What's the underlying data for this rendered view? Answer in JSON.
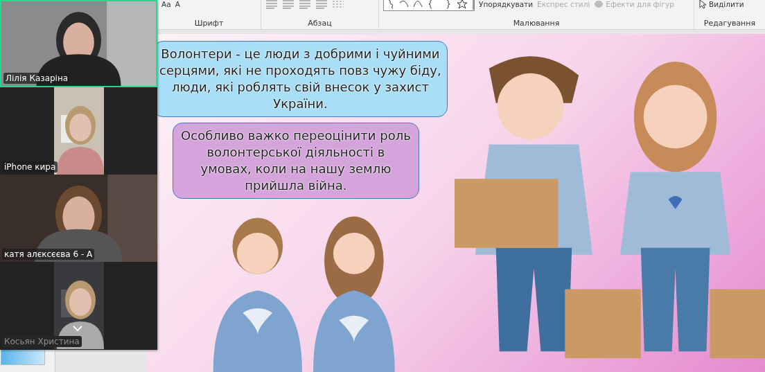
{
  "ribbon": {
    "groups": [
      {
        "label": "Шрифт",
        "items": [
          {
            "kind": "text",
            "label": "Aa",
            "disabled": false
          },
          {
            "kind": "text",
            "label": "A",
            "disabled": false
          }
        ]
      },
      {
        "label": "Абзац",
        "items": [
          {
            "kind": "align"
          },
          {
            "kind": "align"
          },
          {
            "kind": "align"
          },
          {
            "kind": "align"
          },
          {
            "kind": "list"
          }
        ]
      },
      {
        "label": "Малювання",
        "items": [
          {
            "kind": "shapes"
          },
          {
            "kind": "text",
            "label": "Упорядкувати",
            "disabled": false
          },
          {
            "kind": "text",
            "label": "Експрес стилі",
            "disabled": true
          },
          {
            "kind": "effects",
            "label": "Ефекти для фігур",
            "disabled": true
          }
        ]
      },
      {
        "label": "Редагування",
        "items": [
          {
            "kind": "select",
            "label": "Виділити",
            "disabled": false
          }
        ]
      }
    ]
  },
  "participants": [
    {
      "name": "Лілія Казаріна",
      "active": true,
      "dimmed": false,
      "kind": "wide"
    },
    {
      "name": "iPhone кира",
      "active": false,
      "dimmed": false,
      "kind": "portrait"
    },
    {
      "name": "катя алєксєєва 6 - А",
      "active": false,
      "dimmed": false,
      "kind": "wide"
    },
    {
      "name": "Косьян Христина",
      "active": false,
      "dimmed": true,
      "kind": "portrait"
    }
  ],
  "slide": {
    "bubbles": [
      {
        "text": "Волонтери - це люди з добрими і чуйними серцями, які не проходять повз чужу біду, люди, які роблять свій внесок у захист України.",
        "color": "#a9def7"
      },
      {
        "text": "Особливо важко переоцінити роль волонтерської діяльності в умовах, коли на нашу землю прийшла війна.",
        "color": "#d6a4dc"
      }
    ]
  }
}
